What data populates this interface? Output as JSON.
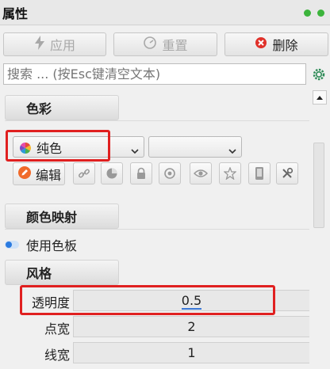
{
  "window": {
    "title": "属性"
  },
  "toolbar": {
    "apply_label": "应用",
    "reset_label": "重置",
    "delete_label": "删除"
  },
  "search": {
    "placeholder": "搜索 ... (按Esc键清空文本)"
  },
  "colors": {
    "accent_red": "#e02020",
    "status_green": "#3cb43c",
    "edit_orange": "#f06a2a",
    "slider_blue": "#3a78d8"
  },
  "color_section": {
    "header": "色彩",
    "color_mode": "纯色",
    "secondary_select": "",
    "edit_label": "编辑",
    "icon_buttons": [
      "link-icon",
      "shading-icon",
      "lock-icon",
      "ring-icon",
      "eye-icon",
      "star-icon",
      "phone-icon",
      "tools-icon"
    ]
  },
  "color_mapping_section": {
    "header": "颜色映射",
    "use_palette_label": "使用色板"
  },
  "style_section": {
    "header": "风格",
    "properties": [
      {
        "label": "透明度",
        "value": "0.5"
      },
      {
        "label": "点宽",
        "value": "2"
      },
      {
        "label": "线宽",
        "value": "1"
      }
    ]
  }
}
